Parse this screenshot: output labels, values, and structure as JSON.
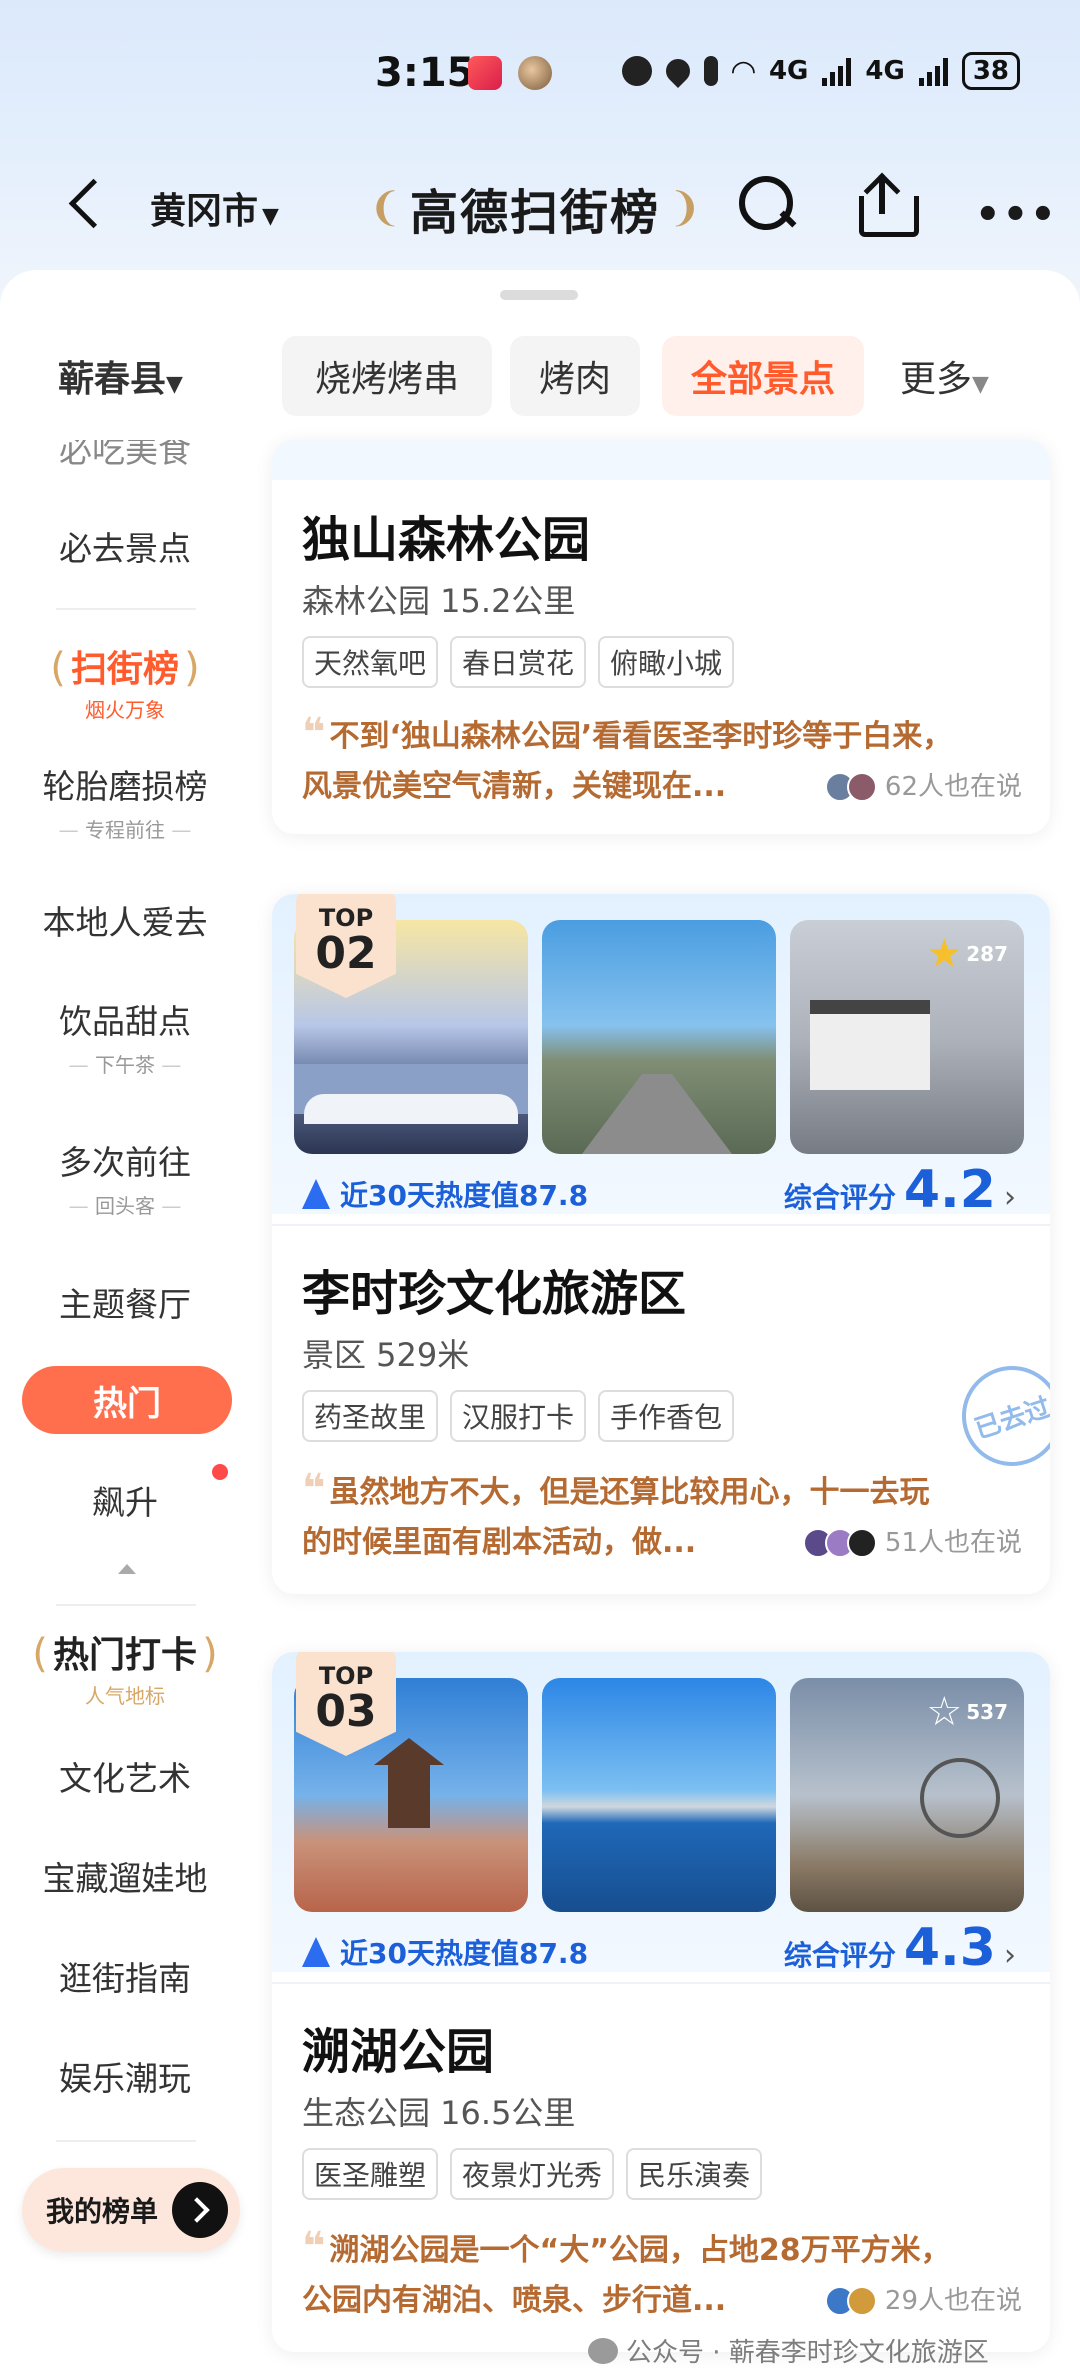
{
  "status_bar": {
    "time": "3:15",
    "network_1": "4G",
    "network_2": "4G",
    "battery": "38"
  },
  "header": {
    "city": "黄冈市",
    "brand": "高德扫街榜"
  },
  "filter": {
    "county": "蕲春县",
    "chips": [
      "烧烤烤串",
      "烤肉",
      "全部景点"
    ],
    "active_chip": "全部景点",
    "more": "更多"
  },
  "sidebar": {
    "cut_top": "必吃美食",
    "must_go": "必去景点",
    "scan_badge": {
      "title": "扫街榜",
      "sub": "烟火万象"
    },
    "tire": {
      "label": "轮胎磨损榜",
      "sub": "专程前往"
    },
    "locals": "本地人爱去",
    "drinks": {
      "label": "饮品甜点",
      "sub": "下午茶"
    },
    "repeat": {
      "label": "多次前往",
      "sub": "回头客"
    },
    "theme": "主题餐厅",
    "hot": "热门",
    "rising": "飙升",
    "hot_checkin": {
      "title": "热门打卡",
      "sub": "人气地标"
    },
    "culture": "文化艺术",
    "kids": "宝藏遛娃地",
    "street": "逛街指南",
    "fun": "娱乐潮玩",
    "my_list": "我的榜单"
  },
  "cards": [
    {
      "name": "独山森林公园",
      "meta": "森林公园 15.2公里",
      "tags": [
        "天然氧吧",
        "春日赏花",
        "俯瞰小城"
      ],
      "quote_l1": "不到‘独山森林公园’看看医圣李时珍等于白来，",
      "quote_l2": "风景优美空气清新，关键现在...",
      "people": "62人也在说"
    },
    {
      "rank_label": "TOP",
      "rank": "02",
      "fav_count": "287",
      "heat": "近30天热度值87.8",
      "score_label": "综合评分",
      "score": "4.2",
      "name": "李时珍文化旅游区",
      "meta": "景区 529米",
      "tags": [
        "药圣故里",
        "汉服打卡",
        "手作香包"
      ],
      "quote_l1": "虽然地方不大，但是还算比较用心，十一去玩",
      "quote_l2": "的时候里面有剧本活动，做...",
      "people": "51人也在说",
      "stamp": "已去过"
    },
    {
      "rank_label": "TOP",
      "rank": "03",
      "fav_count": "537",
      "heat": "近30天热度值87.8",
      "score_label": "综合评分",
      "score": "4.3",
      "name": "溯湖公园",
      "meta": "生态公园 16.5公里",
      "tags": [
        "医圣雕塑",
        "夜景灯光秀",
        "民乐演奏"
      ],
      "quote_l1": "溯湖公园是一个“大”公园，占地28万平方米，",
      "quote_l2": "公园内有湖泊、喷泉、步行道...",
      "people": "29人也在说"
    }
  ],
  "watermark": "公众号 · 蕲春李时珍文化旅游区",
  "colors": {
    "accent": "#ff5b2d",
    "blue": "#1b5fd9",
    "quote": "#b56a32"
  }
}
